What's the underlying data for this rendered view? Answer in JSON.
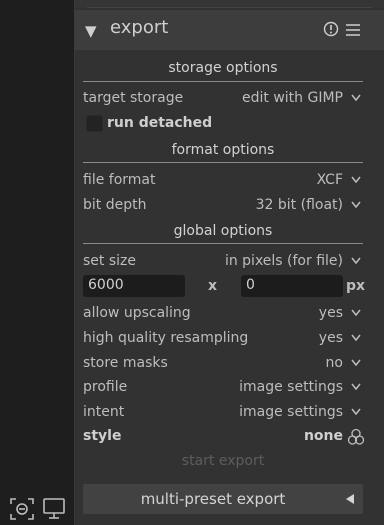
{
  "header": {
    "title": "export"
  },
  "storage_options": {
    "title": "storage options",
    "target_storage": {
      "label": "target storage",
      "value": "edit with GIMP"
    },
    "run_detached": {
      "label": "run detached",
      "checked": false
    }
  },
  "format_options": {
    "title": "format options",
    "file_format": {
      "label": "file format",
      "value": "XCF"
    },
    "bit_depth": {
      "label": "bit depth",
      "value": "32 bit (float)"
    }
  },
  "global_options": {
    "title": "global options",
    "set_size": {
      "label": "set size",
      "value": "in pixels (for file)"
    },
    "width_value": "6000",
    "separator": "x",
    "height_value": "0",
    "unit": "px",
    "allow_upscaling": {
      "label": "allow upscaling",
      "value": "yes"
    },
    "high_quality_resampling": {
      "label": "high quality resampling",
      "value": "yes"
    },
    "store_masks": {
      "label": "store masks",
      "value": "no"
    },
    "profile": {
      "label": "profile",
      "value": "image settings"
    },
    "intent": {
      "label": "intent",
      "value": "image settings"
    },
    "style": {
      "label": "style",
      "value": "none"
    }
  },
  "actions": {
    "start_export": "start export",
    "multi_preset_export": "multi-preset export"
  },
  "colors": {
    "panel_bg": "#323232",
    "header_bg": "#3d3d3d",
    "left_pane_bg": "#1e1e1e",
    "input_bg": "#1c1c1c",
    "button_bg": "#424242"
  },
  "icons": {
    "header": [
      "collapse-triangle-icon",
      "info-icon",
      "presets-menu-icon"
    ],
    "bottom": [
      "focus-peaking-icon",
      "display-icon"
    ],
    "style": "styles-icon",
    "multi_preset": "triangle-left-icon"
  }
}
